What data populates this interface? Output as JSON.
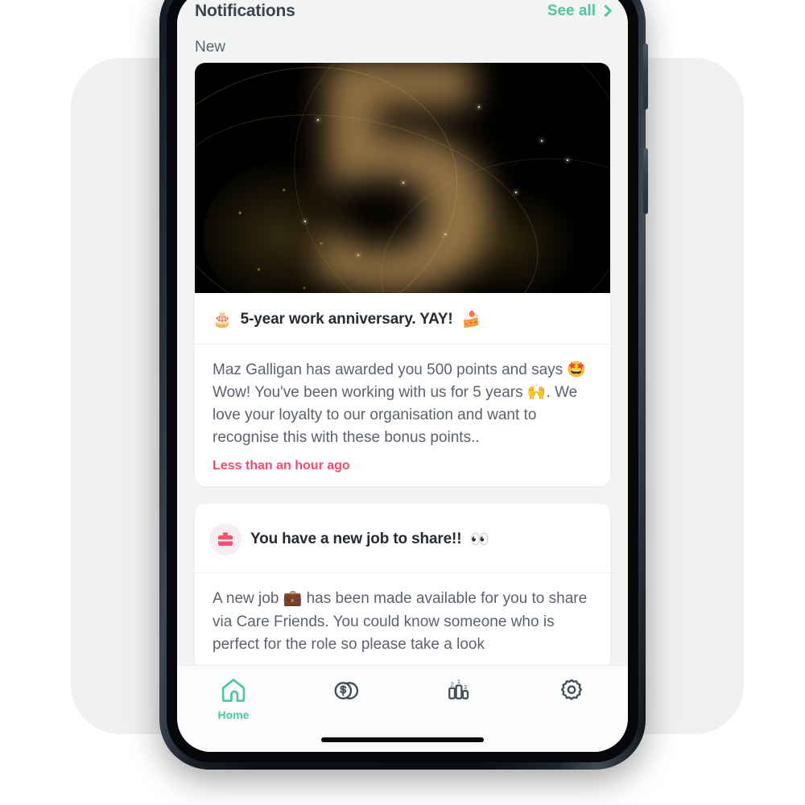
{
  "header": {
    "title": "Notifications",
    "see_all_label": "See all",
    "section_label": "New"
  },
  "theme": {
    "accent_green": "#4ec79c",
    "accent_pink": "#fb4a69",
    "screen_bg": "#f2f5f3",
    "card_bg": "#ffffff",
    "text_dark": "#262b33",
    "text_body": "#5c626d"
  },
  "notifications": [
    {
      "id": "anniversary",
      "hero": {
        "type": "image",
        "number": "5",
        "alt": "Golden balloon number five on black background with gold glitter"
      },
      "title_emoji_left": "🎂",
      "title": "5-year work anniversary. YAY!",
      "title_emoji_right": "🍰",
      "body": "Maz Galligan has awarded you 500 points and says 🤩Wow! You've been working with us for 5 years 🙌. We love your loyalty to our organisation and want to recognise this with these bonus points..",
      "timestamp": "Less than an hour ago"
    },
    {
      "id": "new-job",
      "icon": "briefcase-icon",
      "title": "You have a new job to share!!",
      "title_emoji_right": "👀",
      "body": "A new job 💼 has been made available for you to share via Care Friends. You could know someone who is perfect for the role so please take a look"
    }
  ],
  "bottom_nav": {
    "items": [
      {
        "id": "home",
        "icon": "home-icon",
        "label": "Home",
        "active": true
      },
      {
        "id": "points",
        "icon": "coins-icon",
        "label": "",
        "active": false
      },
      {
        "id": "leaderboard",
        "icon": "leaderboard-icon",
        "label": "",
        "active": false
      },
      {
        "id": "settings",
        "icon": "gear-icon",
        "label": "",
        "active": false
      }
    ]
  }
}
